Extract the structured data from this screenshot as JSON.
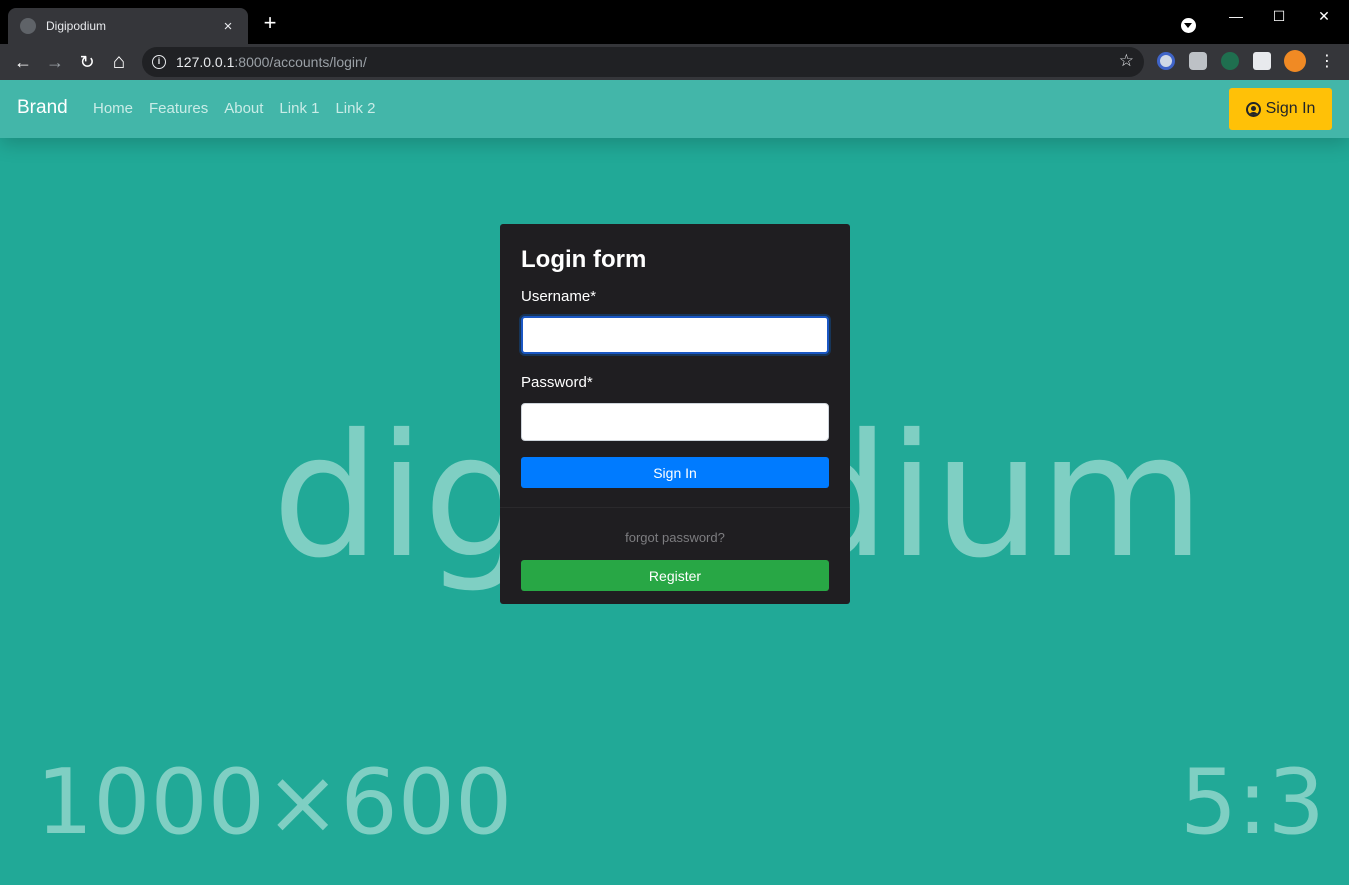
{
  "browser": {
    "tab_title": "Digipodium",
    "tab_close": "×",
    "new_tab": "+",
    "url_host": "127.0.0.1",
    "url_rest": ":8000/accounts/login/",
    "window_controls": {
      "minimize": "—",
      "maximize": "☐",
      "close": "✕"
    },
    "nav": {
      "back": "←",
      "forward": "→",
      "reload": "↻",
      "home": "⌂"
    },
    "star": "☆",
    "extension_icons": [
      "privacy-extension-icon",
      "camera-extension-icon",
      "chat-extension-icon",
      "puzzle-extensions-icon",
      "profile-avatar-icon"
    ],
    "menu": "⋮"
  },
  "navbar": {
    "brand": "Brand",
    "links": [
      "Home",
      "Features",
      "About",
      "Link 1",
      "Link 2"
    ],
    "signin_label": "Sign In"
  },
  "background": {
    "main_text": "digipodium",
    "dims_text": "1000×600",
    "ratio_text": "5:3"
  },
  "login_form": {
    "title": "Login form",
    "username_label": "Username*",
    "username_value": "",
    "password_label": "Password*",
    "password_value": "",
    "submit_label": "Sign In",
    "forgot_label": "forgot password?",
    "register_label": "Register"
  },
  "colors": {
    "navbar": "#43b6a9",
    "page_bg": "#21a997",
    "card_bg": "#1f1e21",
    "primary": "#007bff",
    "success": "#28a745",
    "warning": "#ffc107"
  }
}
